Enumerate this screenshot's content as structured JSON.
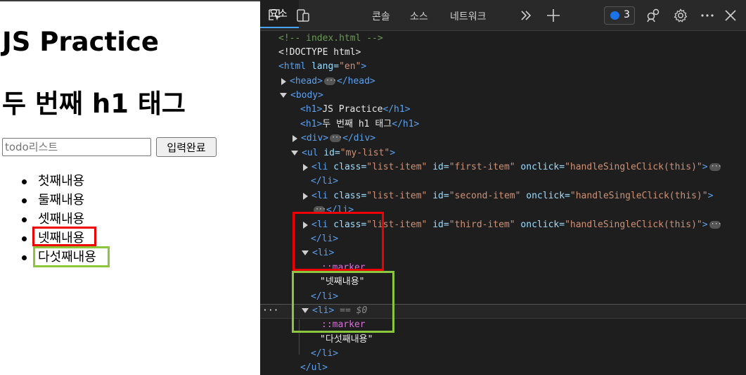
{
  "page": {
    "heading1": "JS Practice",
    "heading2": "두 번째 h1 태그",
    "input_placeholder": "todo리스트",
    "input_value": "",
    "submit_label": "입력완료",
    "list_items": [
      "첫째내용",
      "둘째내용",
      "셋째내용",
      "넷째내용",
      "다섯째내용"
    ]
  },
  "devtools": {
    "tabs": [
      "요소",
      "콘솔",
      "소스",
      "네트워크"
    ],
    "issues_count": "3",
    "icons": [
      "inspect-icon",
      "device-toggle-icon",
      "more-tabs-icon",
      "add-tab-icon",
      "issues-icon",
      "performance-icon",
      "settings-icon",
      "more-options-icon",
      "close-icon"
    ],
    "dom": {
      "comment": "<!-- index.html -->",
      "doctype": "<!DOCTYPE html>",
      "html_open": "<html",
      "lang_attr": " lang=",
      "lang_val": "\"en\"",
      "gt": ">",
      "head_open": "<head>",
      "head_close": "</head>",
      "body_open": "<body>",
      "h1_open": "<h1>",
      "h1_close": "</h1>",
      "h1_text_1": "JS Practice",
      "h1_text_2": "두 번째 h1 태그",
      "div_open": "<div>",
      "div_close": "</div>",
      "ul_open": "<ul",
      "id_attr": " id=",
      "ul_id": "\"my-list\"",
      "li_open": "<li",
      "class_attr": " class=",
      "class_val": "\"list-item\"",
      "onclick_attr": " onclick=",
      "onclick_val": "\"handleSingleClick(this)\"",
      "li_ids": [
        "\"first-item\"",
        "\"second-item\"",
        "\"third-item\""
      ],
      "li_close": "</li>",
      "li_bare": "<li>",
      "marker": "::marker",
      "text_4": "\"넷째내용\"",
      "text_5": "\"다섯째내용\"",
      "sel_ref": "== $0",
      "ul_close": "</ul>",
      "row_dots": "···"
    }
  },
  "colors": {
    "highlight_red": "#e00000",
    "highlight_green": "#8cc63f",
    "devtools_bg": "#1e1e1e",
    "tag_blue": "#5ba0f0",
    "attr_value": "#ce9178"
  }
}
